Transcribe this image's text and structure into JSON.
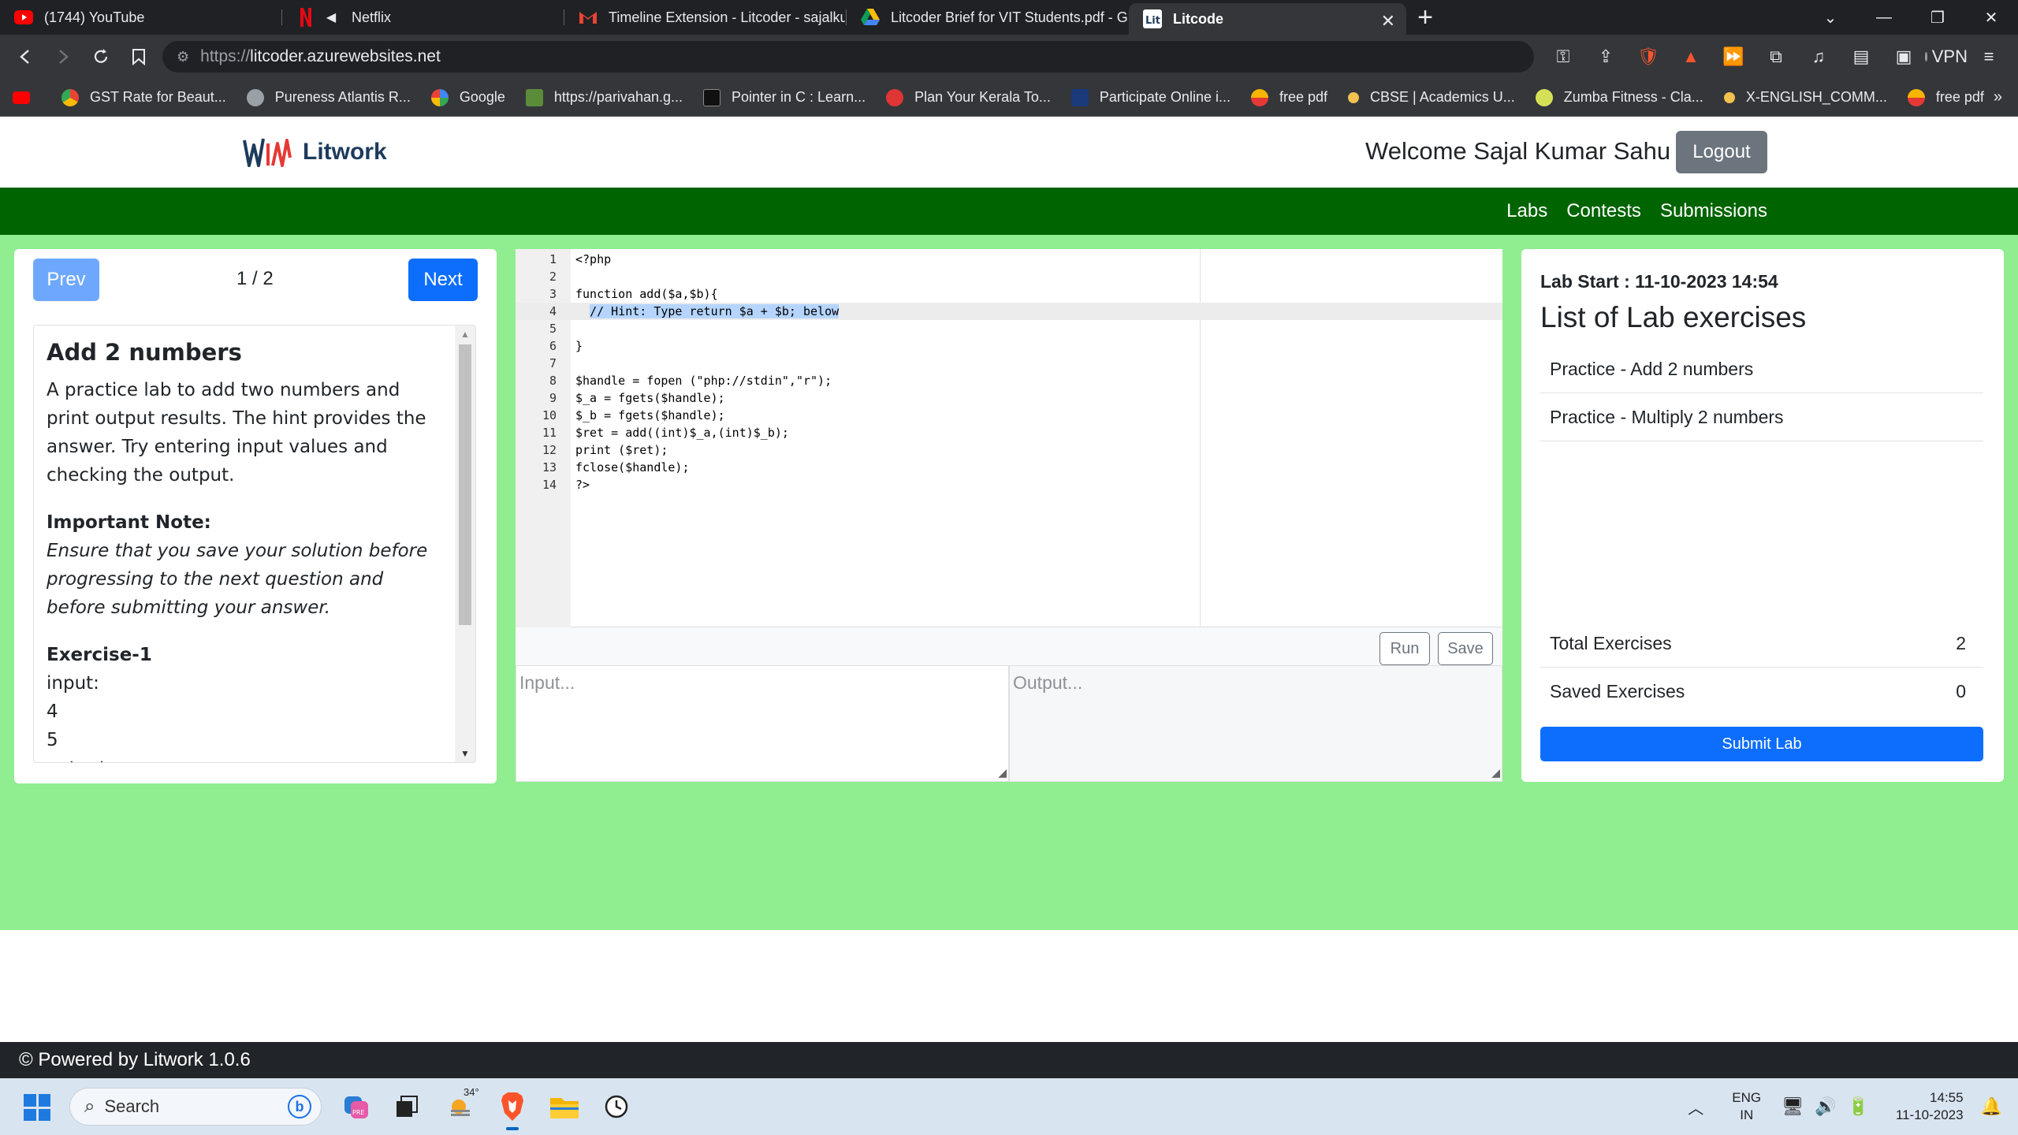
{
  "browser": {
    "tabs": [
      {
        "title": "(1744) YouTube",
        "icon": "youtube-icon"
      },
      {
        "title": "Netflix",
        "icon": "netflix-icon"
      },
      {
        "title": "Timeline Extension - Litcoder - sajalku",
        "icon": "gmail-icon"
      },
      {
        "title": "Litcoder Brief for VIT Students.pdf - Gc",
        "icon": "google-drive-icon"
      },
      {
        "title": "Litcode",
        "icon": "litcode-icon"
      }
    ],
    "url_scheme": "https://",
    "url_host": "litcoder.azurewebsites.net",
    "vpn_label": "VPN",
    "bookmarks": [
      "GST Rate for Beaut...",
      "Pureness Atlantis R...",
      "Google",
      "https://parivahan.g...",
      "Pointer in C : Learn...",
      "Plan Your Kerala To...",
      "Participate Online i...",
      "free pdf",
      "CBSE | Academics U...",
      "Zumba Fitness - Cla...",
      "X-ENGLISH_COMM...",
      "free pdf"
    ]
  },
  "header": {
    "logo_text": "Litwork",
    "welcome": "Welcome Sajal Kumar Sahu",
    "logout_label": "Logout"
  },
  "nav": {
    "items": [
      "Labs",
      "Contests",
      "Submissions"
    ]
  },
  "left": {
    "prev_label": "Prev",
    "next_label": "Next",
    "pager": "1 / 2",
    "title": "Add 2 numbers",
    "description": "A practice lab to add two numbers and print output results. The hint provides the answer. Try entering input values and checking the output.",
    "note_title": "Important Note:",
    "note_text": "Ensure that you save your solution before progressing to the next question and before submitting your answer.",
    "exercise_title": "Exercise-1",
    "input_label": "input:",
    "input_values": [
      "4",
      "5"
    ],
    "output_label": "output:"
  },
  "editor": {
    "lines": [
      "<?php",
      "",
      "function add($a,$b){",
      "  // Hint: Type return $a + $b; below",
      "",
      "}",
      "",
      "$handle = fopen (\"php://stdin\",\"r\");",
      "$_a = fgets($handle);",
      "$_b = fgets($handle);",
      "$ret = add((int)$_a,(int)$_b);",
      "print ($ret);",
      "fclose($handle);",
      "?>"
    ],
    "highlighted_line": 4,
    "run_label": "Run",
    "save_label": "Save",
    "input_placeholder": "Input...",
    "output_placeholder": "Output..."
  },
  "right": {
    "lab_start": "Lab Start : 11-10-2023 14:54",
    "list_title": "List of Lab exercises",
    "exercises": [
      "Practice - Add 2 numbers",
      "Practice - Multiply 2 numbers"
    ],
    "total_label": "Total Exercises",
    "total_value": "2",
    "saved_label": "Saved Exercises",
    "saved_value": "0",
    "submit_label": "Submit Lab"
  },
  "footer": {
    "text": "© Powered by Litwork 1.0.6"
  },
  "taskbar": {
    "search_placeholder": "Search",
    "weather_temp": "34°",
    "lang_top": "ENG",
    "lang_bottom": "IN",
    "time": "14:55",
    "date": "11-10-2023"
  },
  "colors": {
    "nav_green": "#006400",
    "page_green": "#90ee90",
    "primary_blue": "#0d6efd",
    "footer_dark": "#212529"
  }
}
